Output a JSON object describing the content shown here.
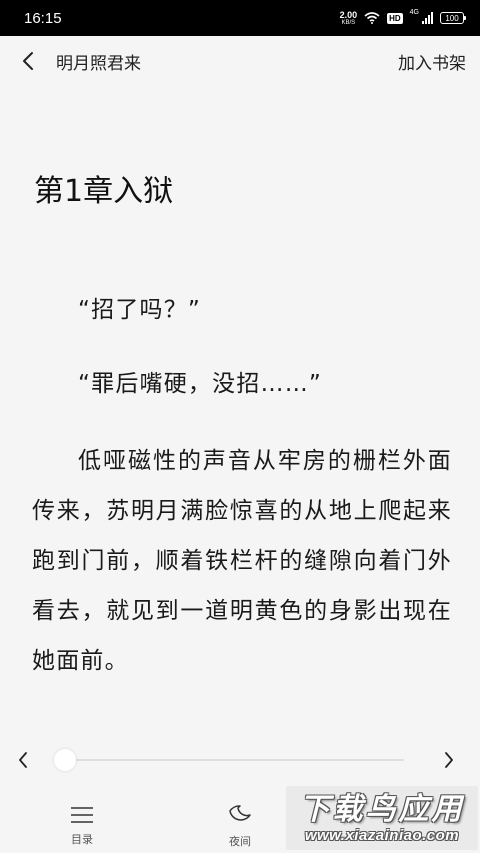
{
  "status_bar": {
    "time": "16:15",
    "net_speed": "2.00",
    "net_unit": "KB/S",
    "hd": "HD",
    "network": "4G",
    "battery": "100"
  },
  "top_bar": {
    "book_title": "明月照君来",
    "add_to_shelf": "加入书架"
  },
  "chapter": {
    "title": "第1章入狱",
    "paragraphs": [
      "“招了吗？”",
      "“罪后嘴硬，没招……”",
      "低哑磁性的声音从牢房的栅栏外面传来，苏明月满脸惊喜的从地上爬起来跑到门前，顺着铁栏杆的缝隙向着门外看去，就见到一道明黄色的身影出现在她面前。"
    ]
  },
  "progress": {
    "position": 0.0
  },
  "toolbar": {
    "catalog_label": "目录",
    "night_label": "夜间"
  },
  "watermark": {
    "title": "下载鸟应用",
    "url": "www.xiazainiao.com"
  },
  "icons": {
    "back": "chevron-left-icon",
    "prev": "chevron-left-icon",
    "next": "chevron-right-icon",
    "catalog": "menu-icon",
    "night": "moon-icon",
    "wifi": "wifi-icon",
    "battery": "battery-icon"
  },
  "colors": {
    "background": "#f5f5f5",
    "text": "#1a1a1a",
    "status_bar": "#000000"
  }
}
